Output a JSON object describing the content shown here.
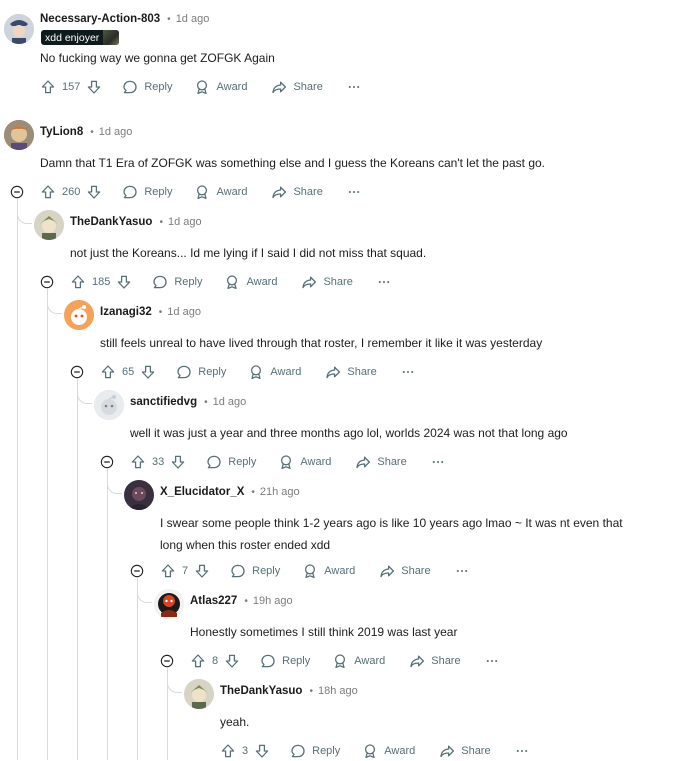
{
  "comments": [
    {
      "author": "Necessary-Action-803",
      "age": "1d ago",
      "flair": "xdd enjoyer",
      "text": "No fucking way we gonna get ZOFGK Again",
      "votes": "157",
      "reply": "Reply",
      "award": "Award",
      "share": "Share",
      "more": "···"
    },
    {
      "author": "TyLion8",
      "age": "1d ago",
      "text": "Damn that T1 Era of ZOFGK was something else and I guess the Koreans can't let the past go.",
      "votes": "260",
      "reply": "Reply",
      "award": "Award",
      "share": "Share",
      "more": "···"
    },
    {
      "author": "TheDankYasuo",
      "age": "1d ago",
      "text": "not just the Koreans... Id me lying if I said I did not miss that squad.",
      "votes": "185",
      "reply": "Reply",
      "award": "Award",
      "share": "Share",
      "more": "···"
    },
    {
      "author": "Izanagi32",
      "age": "1d ago",
      "text": "still feels unreal to have lived through that roster, I remember it like it was yesterday",
      "votes": "65",
      "reply": "Reply",
      "award": "Award",
      "share": "Share",
      "more": "···"
    },
    {
      "author": "sanctifiedvg",
      "age": "1d ago",
      "text": "well it was just a year and three months ago lol, worlds 2024 was not that long ago",
      "votes": "33",
      "reply": "Reply",
      "award": "Award",
      "share": "Share",
      "more": "···"
    },
    {
      "author": "X_Elucidator_X",
      "age": "21h ago",
      "text1": "I swear some people think 1-2 years ago is like 10 years ago lmao ~ It was nt even that",
      "text2": "long when this roster ended xdd",
      "votes": "7",
      "reply": "Reply",
      "award": "Award",
      "share": "Share",
      "more": "···"
    },
    {
      "author": "Atlas227",
      "age": "19h ago",
      "text": "Honestly sometimes I still think 2019 was last year",
      "votes": "8",
      "reply": "Reply",
      "award": "Award",
      "share": "Share",
      "more": "···"
    },
    {
      "author": "TheDankYasuo",
      "age": "18h ago",
      "text": "yeah.",
      "votes": "3",
      "reply": "Reply",
      "award": "Award",
      "share": "Share",
      "more": "···"
    }
  ],
  "icons": {
    "upvote": "upvote-icon",
    "downvote": "downvote-icon",
    "reply": "reply-bubble-icon",
    "award": "award-icon",
    "share": "share-arrow-icon",
    "more": "more-options-icon",
    "collapse": "collapse-minus-icon"
  },
  "colors": {
    "text": "#1c1c1c",
    "meta": "#7c7c7c",
    "action": "#576f76",
    "thread": "#d6dadc",
    "flair_bg": "#0f1a1c"
  }
}
